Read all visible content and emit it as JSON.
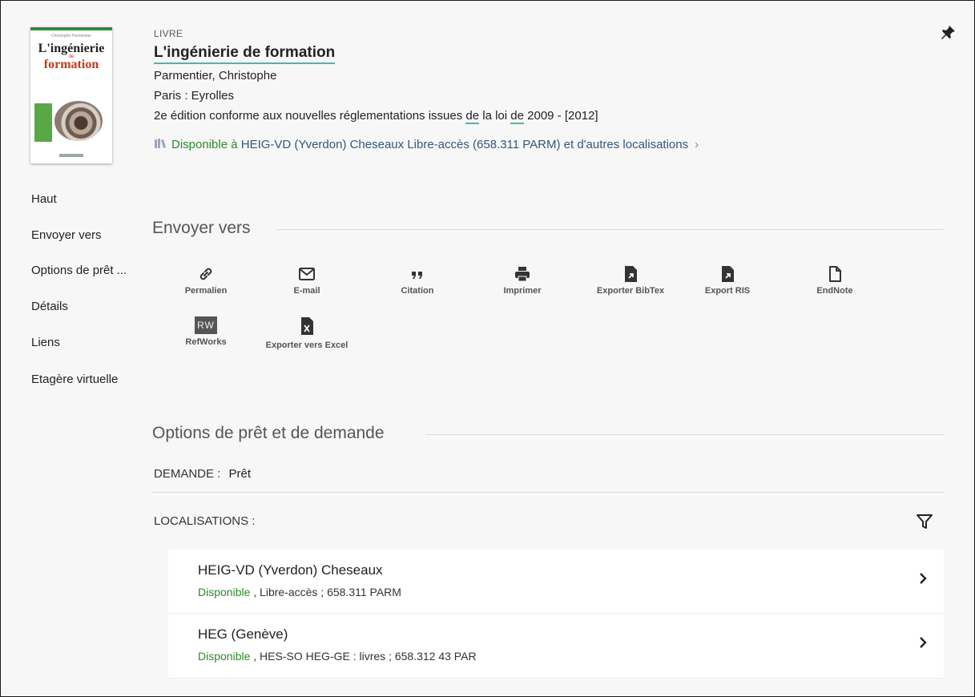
{
  "record": {
    "type": "LIVRE",
    "title": "L'ingénierie de formation",
    "author": "Parmentier, Christophe",
    "publisher": "Paris : Eyrolles",
    "edition_before": "2e édition conforme aux nouvelles réglementations issues ",
    "edition_de1": "de",
    "edition_mid": " la loi ",
    "edition_de2": "de",
    "edition_after": " 2009 - [2012]",
    "availability_status": "Disponible à",
    "availability_location": " HEIG-VD (Yverdon) Cheseaux  Libre-accès (658.311 PARM) et d'autres localisations",
    "availability_chevron": "›"
  },
  "cover": {
    "author": "Christophe Parmentier",
    "title_line1": "L'ingénierie",
    "title_line2": "formation"
  },
  "nav": {
    "items": [
      "Haut",
      "Envoyer vers",
      "Options de prêt ...",
      "Détails",
      "Liens",
      "Etagère virtuelle"
    ]
  },
  "send_to": {
    "heading": "Envoyer vers",
    "actions": [
      "Permalien",
      "E-mail",
      "Citation",
      "Imprimer",
      "Exporter BibTex",
      "Export RIS",
      "EndNote",
      "RefWorks",
      "Exporter vers Excel"
    ],
    "refworks_badge": "RW"
  },
  "loan": {
    "heading": "Options de prêt et de demande",
    "request_label": "DEMANDE :",
    "request_value": "Prêt",
    "locations_label": "LOCALISATIONS :",
    "locations": [
      {
        "name": "HEIG-VD (Yverdon) Cheseaux",
        "status": "Disponible",
        "detail": " , Libre-accès ; 658.311 PARM"
      },
      {
        "name": "HEG (Genève)",
        "status": "Disponible",
        "detail": " , HES-SO HEG-GE : livres ; 658.312 43 PAR"
      }
    ]
  },
  "colors": {
    "accent": "#3dbdb0",
    "available": "#2b8a2b",
    "link": "#35567a"
  }
}
